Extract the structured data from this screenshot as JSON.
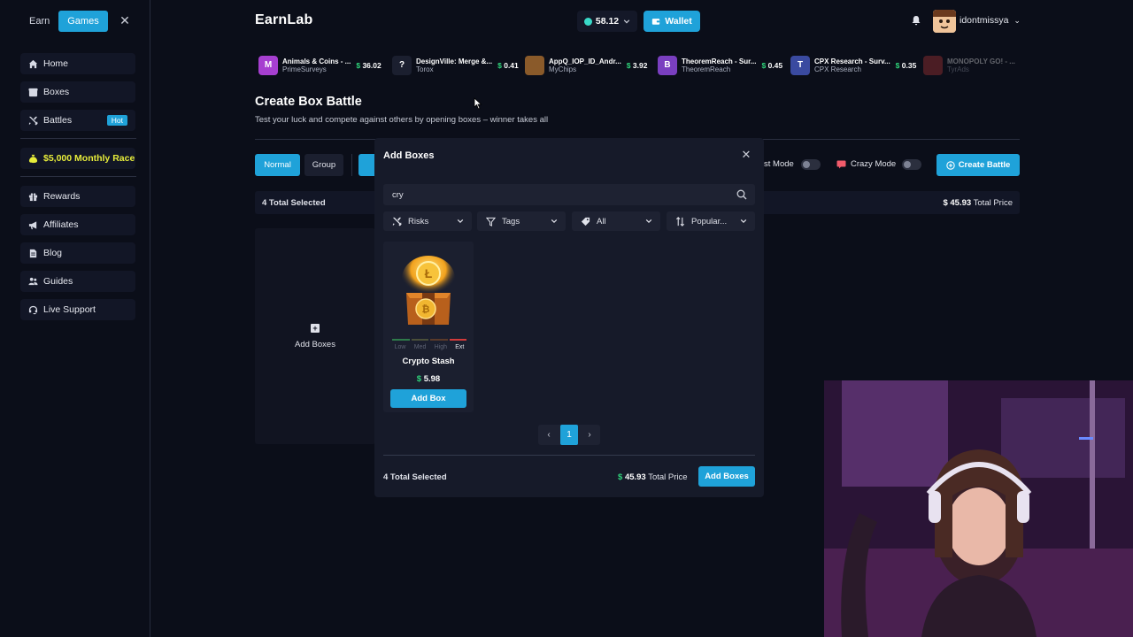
{
  "sidebar": {
    "top_tabs": [
      "Earn",
      "Games"
    ],
    "close": "✕",
    "nav": [
      {
        "label": "Home",
        "icon": "home-icon"
      },
      {
        "label": "Boxes",
        "icon": "box-icon"
      },
      {
        "label": "Battles",
        "icon": "swords-icon",
        "badge": "Hot"
      }
    ],
    "race": "$5,000 Monthly Race",
    "nav2": [
      {
        "label": "Rewards",
        "icon": "gift-icon"
      },
      {
        "label": "Affiliates",
        "icon": "megaphone-icon"
      },
      {
        "label": "Blog",
        "icon": "document-icon"
      },
      {
        "label": "Guides",
        "icon": "guide-icon"
      },
      {
        "label": "Live Support",
        "icon": "headset-icon"
      }
    ]
  },
  "header": {
    "logo_text": "EarnLab",
    "balance": "58.12",
    "wallet": "Wallet",
    "username": "idontmissya"
  },
  "offers": [
    {
      "icon": "M",
      "color": "#a63fd0",
      "title": "Animals & Coins - ...",
      "source": "PrimeSurveys",
      "price": "36.02"
    },
    {
      "icon": "?",
      "color": "#1b1f2f",
      "title": "DesignVille: Merge &...",
      "source": "Torox",
      "price": "0.41"
    },
    {
      "icon": "",
      "color": "#8a5a2a",
      "title": "AppQ_IOP_ID_Andr...",
      "source": "MyChips",
      "price": "3.92"
    },
    {
      "icon": "B",
      "color": "#7a3fc0",
      "title": "TheoremReach - Sur...",
      "source": "TheoremReach",
      "price": "0.45"
    },
    {
      "icon": "T",
      "color": "#3a4aa0",
      "title": "CPX Research - Surv...",
      "source": "CPX Research",
      "price": "0.35"
    },
    {
      "icon": "",
      "color": "#c23a3a",
      "title": "MONOPOLY GO! - ...",
      "source": "TyrAds",
      "price": ""
    }
  ],
  "page": {
    "title": "Create Box Battle",
    "subtitle": "Test your luck and compete against others by opening boxes – winner takes all",
    "mode_normal": "Normal",
    "mode_group": "Group",
    "fast_mode": "st Mode",
    "crazy_mode": "Crazy Mode",
    "create_battle": "Create Battle",
    "total_selected": "4 Total Selected",
    "total_price_value": "$ 45.93",
    "total_price_label": "Total Price",
    "add_boxes": "Add Boxes"
  },
  "modal": {
    "title": "Add Boxes",
    "close": "✕",
    "search_value": "cry",
    "filters": [
      "Risks",
      "Tags",
      "All",
      "Popular..."
    ],
    "card": {
      "name": "Crypto Stash",
      "price_symbol": "$",
      "price": "5.98",
      "button": "Add Box",
      "risk_levels": [
        "Low",
        "Med",
        "High",
        "Ext"
      ],
      "risk_active": "Ext"
    },
    "page": "1",
    "footer_selected": "4 Total Selected",
    "footer_price_symbol": "$",
    "footer_price": "45.93",
    "footer_price_label": "Total Price",
    "footer_button": "Add Boxes"
  },
  "colors": {
    "accent": "#1fa2d9",
    "green": "#2fd37a",
    "race": "#e7ec3a"
  }
}
